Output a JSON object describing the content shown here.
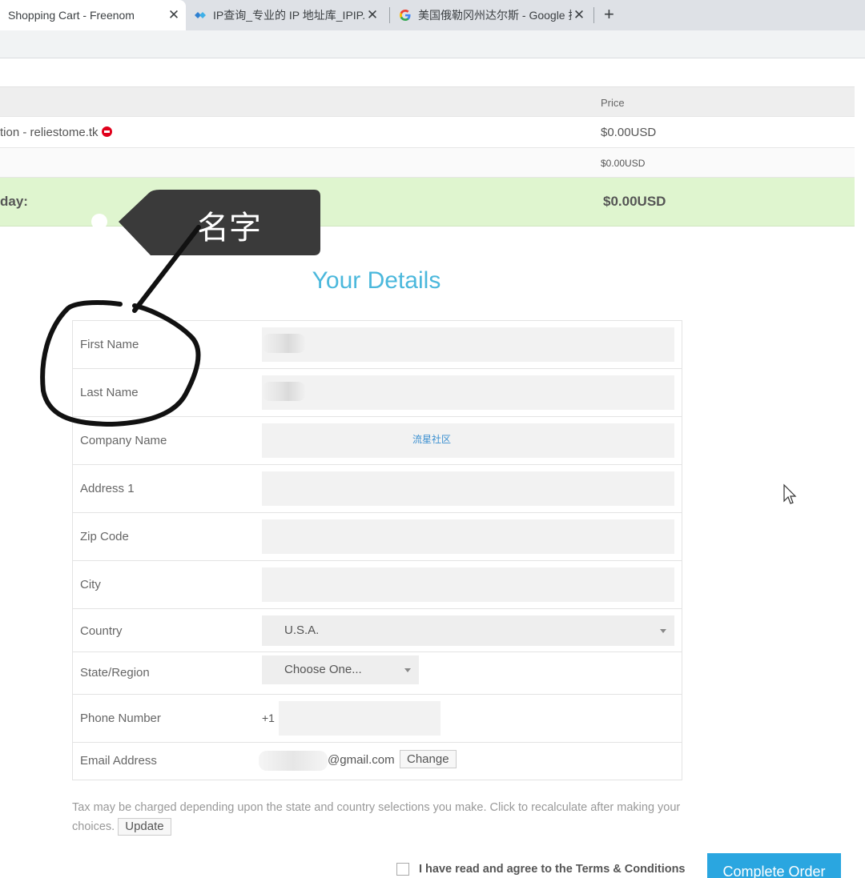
{
  "browser": {
    "tabs": [
      {
        "title": "Shopping Cart - Freenom",
        "active": true,
        "icon": "freenom-favicon"
      },
      {
        "title": "IP查询_专业的 IP 地址库_IPIP.NE",
        "active": false,
        "icon": "ipip-favicon"
      },
      {
        "title": "美国俄勒冈州达尔斯 - Google 搜",
        "active": false,
        "icon": "google-favicon"
      }
    ],
    "close_glyph": "✕",
    "new_tab_glyph": "+"
  },
  "cart": {
    "price_header": "Price",
    "item": {
      "description": "tion - reliestome.tk",
      "price": "$0.00USD",
      "icon": "remove-icon"
    },
    "subtotal": {
      "price": "$0.00USD"
    },
    "total": {
      "label": "day:",
      "price": "$0.00USD"
    }
  },
  "annotation": {
    "callout_text": "名字",
    "color": "#3a3a3a"
  },
  "details": {
    "title": "Your Details",
    "title_color": "#4bb8dc",
    "fields": {
      "first_name": {
        "label": "First Name",
        "value": ""
      },
      "last_name": {
        "label": "Last Name",
        "value": ""
      },
      "company_name": {
        "label": "Company Name",
        "value": "",
        "watermark": "流星社区"
      },
      "address1": {
        "label": "Address 1",
        "value": ""
      },
      "zip_code": {
        "label": "Zip Code",
        "value": ""
      },
      "city": {
        "label": "City",
        "value": ""
      },
      "country": {
        "label": "Country",
        "value": "U.S.A."
      },
      "state": {
        "label": "State/Region",
        "value": "Choose One..."
      },
      "phone": {
        "label": "Phone Number",
        "prefix": "+1",
        "value": ""
      },
      "email": {
        "label": "Email Address",
        "suffix": "@gmail.com",
        "change_label": "Change"
      }
    }
  },
  "tax": {
    "text": "Tax may be charged depending upon the state and country selections you make. Click to recalculate after making your choices.",
    "update_label": "Update"
  },
  "agree": {
    "text": "I have read and agree to the Terms & Conditions"
  },
  "complete_order": {
    "label": "Complete Order",
    "color": "#2aa6e0"
  }
}
